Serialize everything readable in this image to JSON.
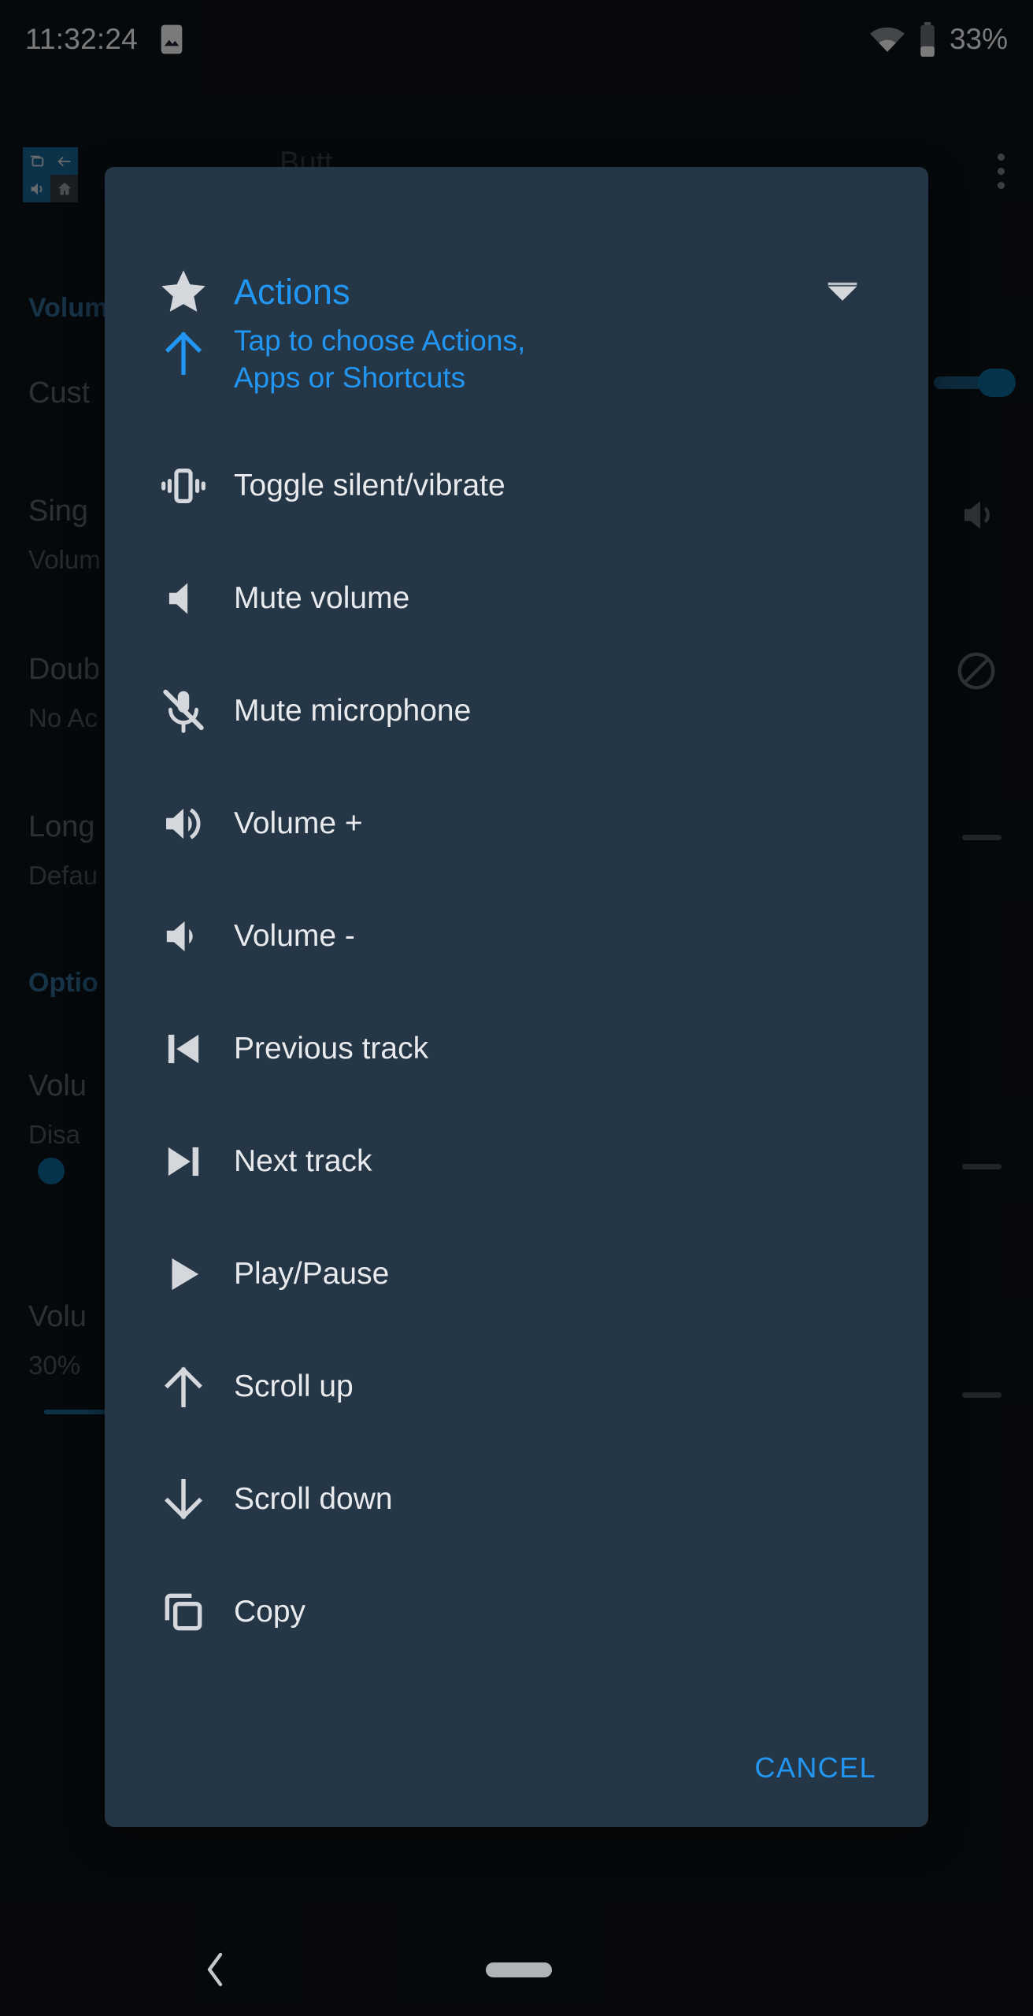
{
  "statusbar": {
    "time": "11:32:24",
    "battery_percent": "33%",
    "icons": [
      "image-icon",
      "wifi-icon",
      "battery-icon"
    ]
  },
  "background_page": {
    "toolbar_title": "Butt",
    "sections": [
      {
        "heading": "Volum"
      },
      {
        "heading": "Optio"
      }
    ],
    "items": [
      {
        "title": "Cust",
        "subtitle": ""
      },
      {
        "title": "Sing",
        "subtitle": "Volum"
      },
      {
        "title": "Doub",
        "subtitle": "No Ac"
      },
      {
        "title": "Long",
        "subtitle": "Defau"
      },
      {
        "title": "Volu",
        "subtitle": "Disa"
      },
      {
        "title": "Volu",
        "subtitle": "30%"
      }
    ],
    "overflow_menu": "overflow-menu-icon",
    "floating_controls": [
      "recents-icon",
      "back-icon",
      "volume-icon",
      "home-icon"
    ],
    "right_icons": [
      "volume-icon",
      "do-not-disturb-icon"
    ]
  },
  "dialog": {
    "title": "Actions",
    "title_icon": "star-icon",
    "dropdown_icon": "caret-down-icon",
    "hint_icon": "arrow-up-icon",
    "hint_text": "Tap to choose Actions, Apps or Shortcuts",
    "hint_line1": "Tap to choose Actions,",
    "hint_line2": "Apps or Shortcuts",
    "cancel_label": "CANCEL",
    "items": [
      {
        "label": "Toggle silent/vibrate",
        "icon": "vibration-icon"
      },
      {
        "label": "Mute volume",
        "icon": "volume-mute-icon"
      },
      {
        "label": "Mute microphone",
        "icon": "mic-off-icon"
      },
      {
        "label": "Volume +",
        "icon": "volume-up-icon"
      },
      {
        "label": "Volume -",
        "icon": "volume-down-icon"
      },
      {
        "label": "Previous track",
        "icon": "skip-previous-icon"
      },
      {
        "label": "Next track",
        "icon": "skip-next-icon"
      },
      {
        "label": "Play/Pause",
        "icon": "play-icon"
      },
      {
        "label": "Scroll up",
        "icon": "arrow-up-icon"
      },
      {
        "label": "Scroll down",
        "icon": "arrow-down-icon"
      },
      {
        "label": "Copy",
        "icon": "content-copy-icon"
      }
    ]
  },
  "navbar": {
    "back_label": "back-icon",
    "home_label": "home-pill"
  },
  "colors": {
    "accent_blue": "#2196f3",
    "dialog_bg": "#253646",
    "page_bg": "#0e131a",
    "text_primary": "#e8eaed",
    "toggle_on": "#0c6b9e"
  }
}
